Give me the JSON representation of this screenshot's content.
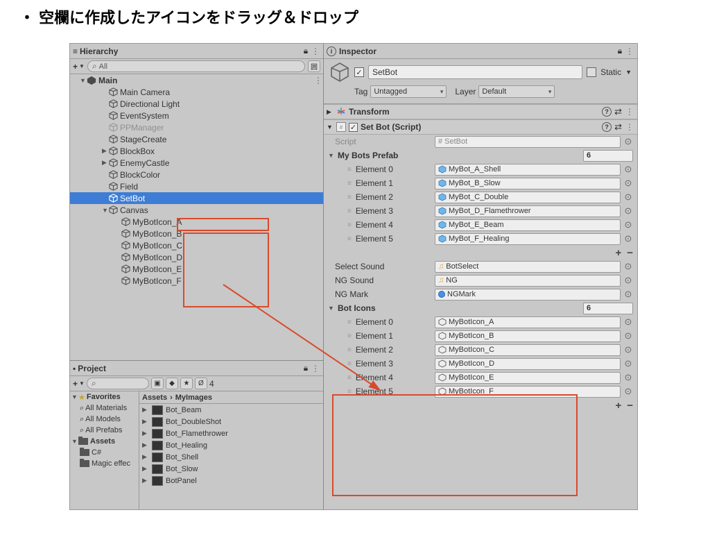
{
  "title": "空欄に作成したアイコンをドラッグ＆ドロップ",
  "hierarchy": {
    "label": "Hierarchy",
    "search": "All",
    "scene": "Main",
    "items": [
      {
        "name": "Main Camera",
        "depth": 2
      },
      {
        "name": "Directional Light",
        "depth": 2
      },
      {
        "name": "EventSystem",
        "depth": 2
      },
      {
        "name": "PPManager",
        "depth": 2,
        "dim": true
      },
      {
        "name": "StageCreate",
        "depth": 2
      },
      {
        "name": "BlockBox",
        "depth": 2,
        "fold": "▶"
      },
      {
        "name": "EnemyCastle",
        "depth": 2,
        "fold": "▶"
      },
      {
        "name": "BlockColor",
        "depth": 2
      },
      {
        "name": "Field",
        "depth": 2
      },
      {
        "name": "SetBot",
        "depth": 2,
        "sel": true
      },
      {
        "name": "Canvas",
        "depth": 2,
        "fold": "▼"
      },
      {
        "name": "MyBotIcon_A",
        "depth": 3
      },
      {
        "name": "MyBotIcon_B",
        "depth": 3
      },
      {
        "name": "MyBotIcon_C",
        "depth": 3
      },
      {
        "name": "MyBotIcon_D",
        "depth": 3
      },
      {
        "name": "MyBotIcon_E",
        "depth": 3
      },
      {
        "name": "MyBotIcon_F",
        "depth": 3
      }
    ]
  },
  "project": {
    "label": "Project",
    "crumb_root": "Assets",
    "crumb_sub": "MyImages",
    "count": "4",
    "favorites": "Favorites",
    "fav_items": [
      "All Materials",
      "All Models",
      "All Prefabs"
    ],
    "assets_label": "Assets",
    "folders": [
      "C#",
      "Magic effec"
    ],
    "assets": [
      "Bot_Beam",
      "Bot_DoubleShot",
      "Bot_Flamethrower",
      "Bot_Healing",
      "Bot_Shell",
      "Bot_Slow",
      "BotPanel"
    ]
  },
  "inspector": {
    "label": "Inspector",
    "name": "SetBot",
    "static": "Static",
    "tag_lbl": "Tag",
    "tag": "Untagged",
    "layer_lbl": "Layer",
    "layer": "Default",
    "transform": "Transform",
    "setbot_comp": "Set Bot (Script)",
    "script_lbl": "Script",
    "script_val": "SetBot",
    "prefab_hdr": "My Bots Prefab",
    "prefab_count": "6",
    "prefabs": [
      {
        "lbl": "Element 0",
        "val": "MyBot_A_Shell"
      },
      {
        "lbl": "Element 1",
        "val": "MyBot_B_Slow"
      },
      {
        "lbl": "Element 2",
        "val": "MyBot_C_Double"
      },
      {
        "lbl": "Element 3",
        "val": "MyBot_D_Flamethrower"
      },
      {
        "lbl": "Element 4",
        "val": "MyBot_E_Beam"
      },
      {
        "lbl": "Element 5",
        "val": "MyBot_F_Healing"
      }
    ],
    "sel_sound_lbl": "Select Sound",
    "sel_sound": "BotSelect",
    "ng_sound_lbl": "NG Sound",
    "ng_sound": "NG",
    "ng_mark_lbl": "NG Mark",
    "ng_mark": "NGMark",
    "icons_hdr": "Bot Icons",
    "icons_count": "6",
    "icons": [
      {
        "lbl": "Element 0",
        "val": "MyBotIcon_A"
      },
      {
        "lbl": "Element 1",
        "val": "MyBotIcon_B"
      },
      {
        "lbl": "Element 2",
        "val": "MyBotIcon_C"
      },
      {
        "lbl": "Element 3",
        "val": "MyBotIcon_D"
      },
      {
        "lbl": "Element 4",
        "val": "MyBotIcon_E"
      },
      {
        "lbl": "Element 5",
        "val": "MyBotIcon_F"
      }
    ]
  }
}
